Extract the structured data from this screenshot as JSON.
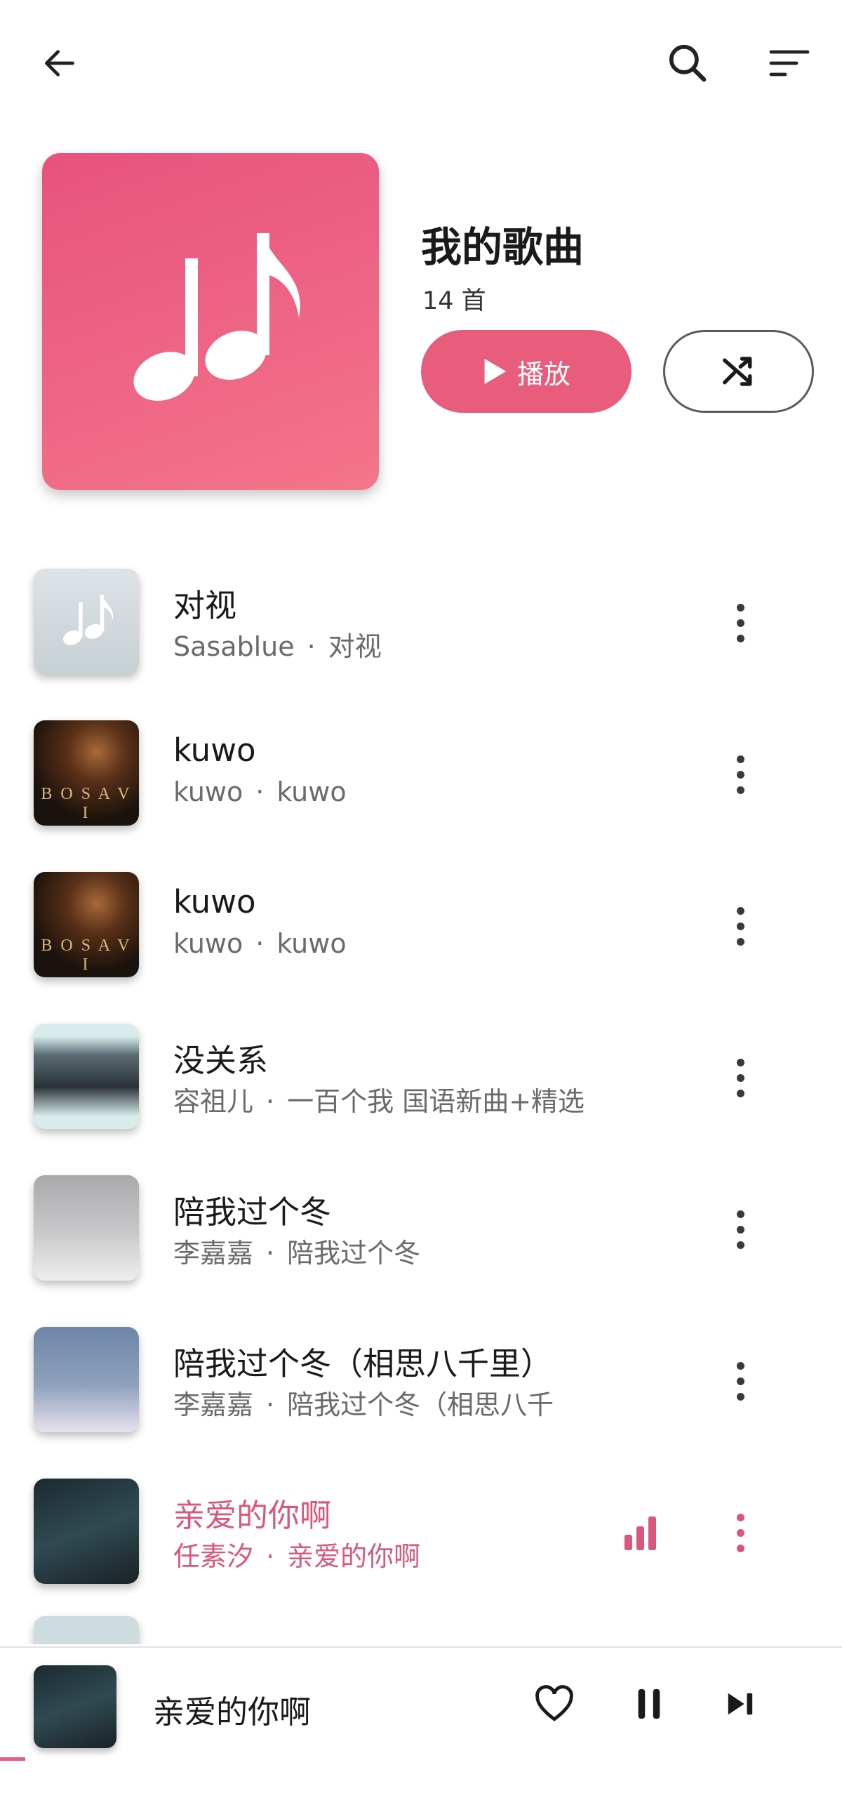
{
  "toolbar": {
    "back_icon": "arrow-left-icon",
    "search_icon": "search-icon",
    "sort_icon": "sort-icon"
  },
  "playlist": {
    "title": "我的歌曲",
    "count": "14 首",
    "play_label": "播放",
    "accent": "#e85c7c"
  },
  "songs": [
    {
      "title": "对视",
      "artist": "Sasablue",
      "album": "对视",
      "active": false
    },
    {
      "title": "kuwo",
      "artist": "kuwo",
      "album": "kuwo",
      "active": false
    },
    {
      "title": "kuwo",
      "artist": "kuwo",
      "album": "kuwo",
      "active": false
    },
    {
      "title": "没关系",
      "artist": "容祖儿",
      "album": "一百个我 国语新曲+精选",
      "active": false
    },
    {
      "title": "陪我过个冬",
      "artist": "李嘉嘉",
      "album": "陪我过个冬",
      "active": false
    },
    {
      "title": "陪我过个冬（相思八千里）",
      "artist": "李嘉嘉",
      "album": "陪我过个冬（相思八千",
      "active": false
    },
    {
      "title": "亲爱的你啊",
      "artist": "任素汐",
      "album": "亲爱的你啊",
      "active": true
    }
  ],
  "player": {
    "title": "亲爱的你啊",
    "progress": 0.03
  }
}
